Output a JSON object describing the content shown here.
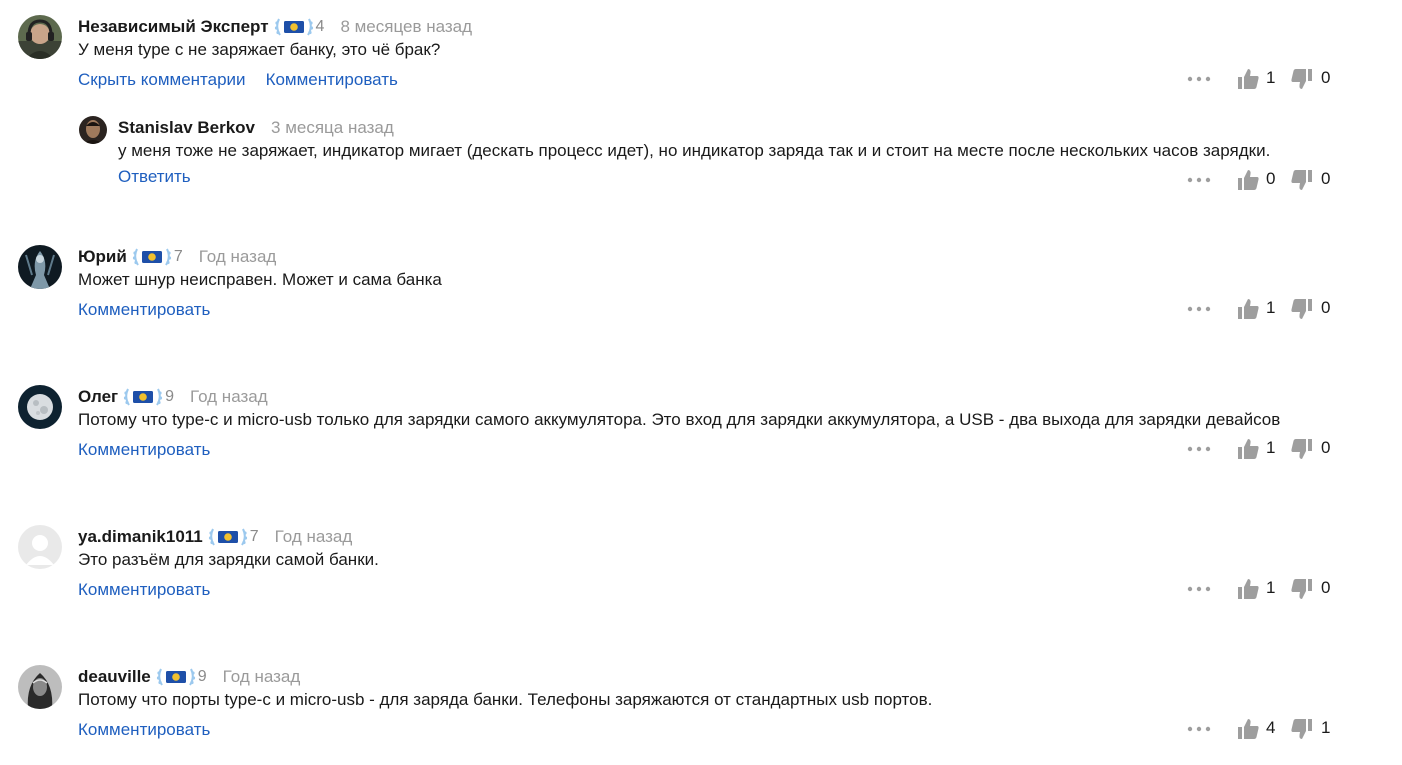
{
  "comments": [
    {
      "author": "Независимый Эксперт",
      "level": "4",
      "time": "8 месяцев назад",
      "text": "У меня type c не заряжает банку, это чё брак?",
      "actions": [
        "Скрыть комментарии",
        "Комментировать"
      ],
      "likes": "1",
      "dislikes": "0",
      "avatar_icon": "person-headphones-avatar"
    },
    {
      "author": "Stanislav Berkov",
      "time": "3 месяца назад",
      "text": "у меня тоже не заряжает, индикатор мигает (дескать процесс идет), но индикатор заряда так и и стоит на месте после нескольких часов зарядки.",
      "actions": [
        "Ответить"
      ],
      "likes": "0",
      "dislikes": "0",
      "avatar_icon": "person-face-avatar"
    },
    {
      "author": "Юрий",
      "level": "7",
      "time": "Год назад",
      "text": "Может шнур неисправен. Может и сама банка",
      "actions": [
        "Комментировать"
      ],
      "likes": "1",
      "dislikes": "0",
      "avatar_icon": "dark-figure-avatar"
    },
    {
      "author": "Олег",
      "level": "9",
      "time": "Год назад",
      "text": "Потому что type-c и micro-usb только для зарядки самого аккумулятора. Это вход для зарядки аккумулятора, а USB - два выхода для зарядки девайсов",
      "actions": [
        "Комментировать"
      ],
      "likes": "1",
      "dislikes": "0",
      "avatar_icon": "moon-avatar"
    },
    {
      "author": "ya.dimanik1011",
      "level": "7",
      "time": "Год назад",
      "text": "Это разъём для зарядки самой банки.",
      "actions": [
        "Комментировать"
      ],
      "likes": "1",
      "dislikes": "0",
      "avatar_icon": "default-user-avatar"
    },
    {
      "author": "deauville",
      "level": "9",
      "time": "Год назад",
      "text": "Потому что порты type-c и micro-usb - для заряда банки. Телефоны заряжаются от стандартных usb портов.",
      "actions": [
        "Комментировать"
      ],
      "likes": "4",
      "dislikes": "1",
      "avatar_icon": "mono-portrait-avatar"
    }
  ],
  "colors": {
    "link": "#1f5fbf",
    "muted": "#9a9a9a",
    "icon": "#9e9e9e",
    "badge_blue": "#1e4fa8",
    "badge_gold": "#f2c12e",
    "laurel": "#9cc9ee"
  }
}
